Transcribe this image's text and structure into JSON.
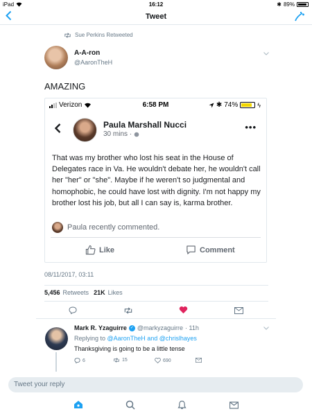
{
  "status_bar": {
    "device": "iPad",
    "time": "16:12",
    "battery": "89%"
  },
  "nav": {
    "title": "Tweet",
    "back_icon": "chevron-left-icon",
    "compose_icon": "compose-icon"
  },
  "retweet_context": "Sue Perkins Retweeted",
  "author": {
    "name": "A-A-ron",
    "handle": "@AaronTheH"
  },
  "tweet_text": "AMAZING",
  "embedded_post": {
    "status": {
      "carrier": "Verizon",
      "time": "6:58 PM",
      "battery": "74%"
    },
    "name": "Paula Marshall Nucci",
    "meta": "30 mins ·",
    "body": "That was my brother who lost his seat in the House of Delegates race in Va.  He wouldn't debate her, he wouldn't call her \"her\" or \"she\".  Maybe if he weren't so judgmental and homophobic, he could have lost with dignity.  I'm not happy my brother lost his job, but all I can say is, karma brother.",
    "commented": "Paula recently commented.",
    "like_label": "Like",
    "comment_label": "Comment"
  },
  "timestamp": "08/11/2017, 03:11",
  "counts": {
    "retweets_value": "5,456",
    "retweets_label": "Retweets",
    "likes_value": "21K",
    "likes_label": "Likes"
  },
  "colors": {
    "accent": "#1da1f2",
    "like": "#e0245e",
    "muted": "#657786"
  },
  "reply": {
    "name": "Mark R. Yzaguirre",
    "handle": "@markyzaguirre",
    "time": "· 11h",
    "replying_prefix": "Replying to",
    "replying_to_1": "@AaronTheH",
    "replying_and": "and",
    "replying_to_2": "@chrislhayes",
    "text": "Thanksgiving is going to be a little tense",
    "replies": "6",
    "retweets": "15",
    "likes": "690"
  },
  "composer_placeholder": "Tweet your reply"
}
